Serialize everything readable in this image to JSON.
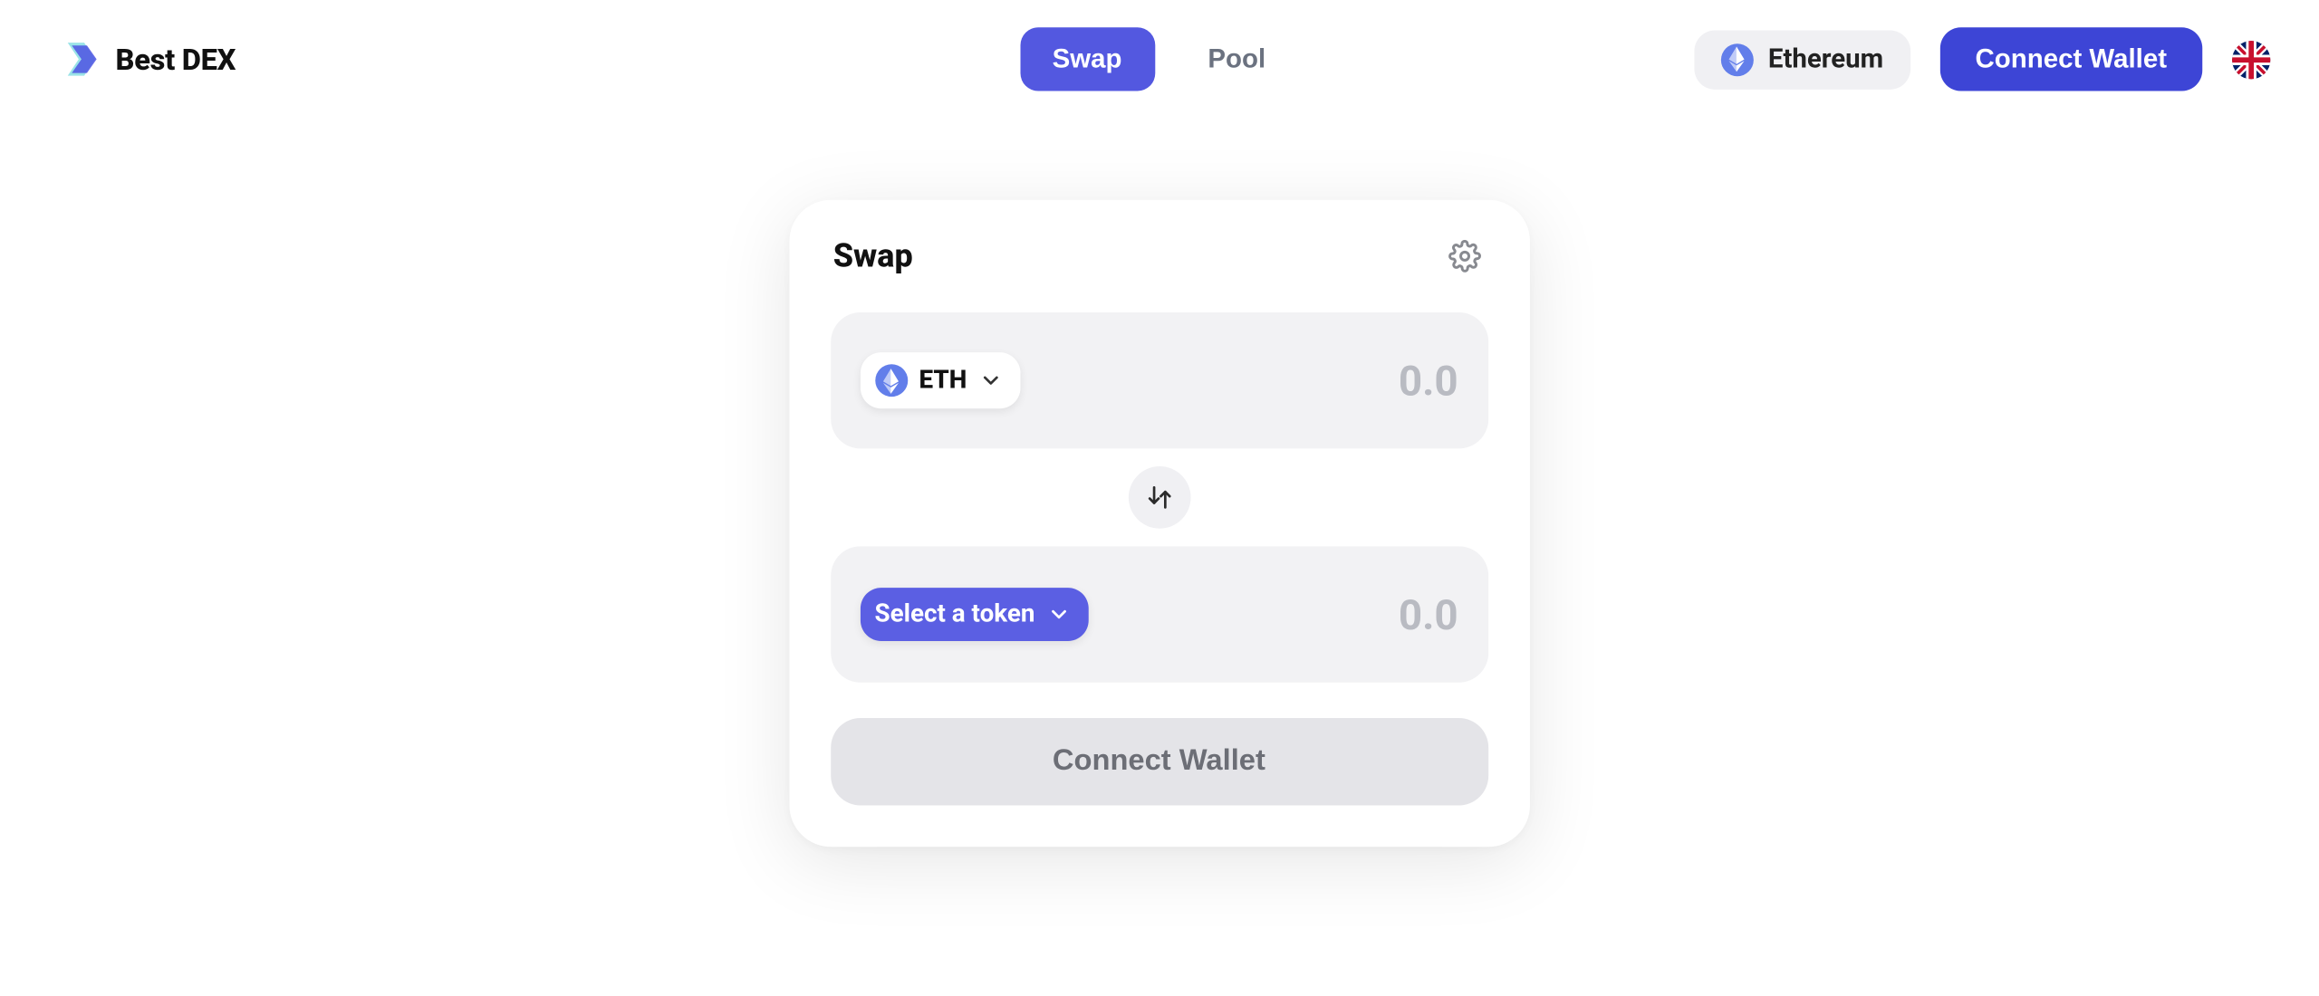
{
  "app": {
    "name": "Best DEX"
  },
  "header": {
    "nav": [
      {
        "label": "Swap",
        "active": true
      },
      {
        "label": "Pool",
        "active": false
      }
    ],
    "network": {
      "name": "Ethereum"
    },
    "connect_wallet_label": "Connect Wallet",
    "language_flag": "uk"
  },
  "swap_card": {
    "title": "Swap",
    "from": {
      "token_symbol": "ETH",
      "amount_placeholder": "0.0"
    },
    "to": {
      "select_label": "Select a token",
      "amount_placeholder": "0.0"
    },
    "cta_label": "Connect Wallet"
  },
  "colors": {
    "primary": "#5358e0",
    "primary_dark": "#3d45d6",
    "panel_bg": "#f2f2f4",
    "text": "#111",
    "muted": "#6b7280",
    "eth": "#627eea"
  }
}
